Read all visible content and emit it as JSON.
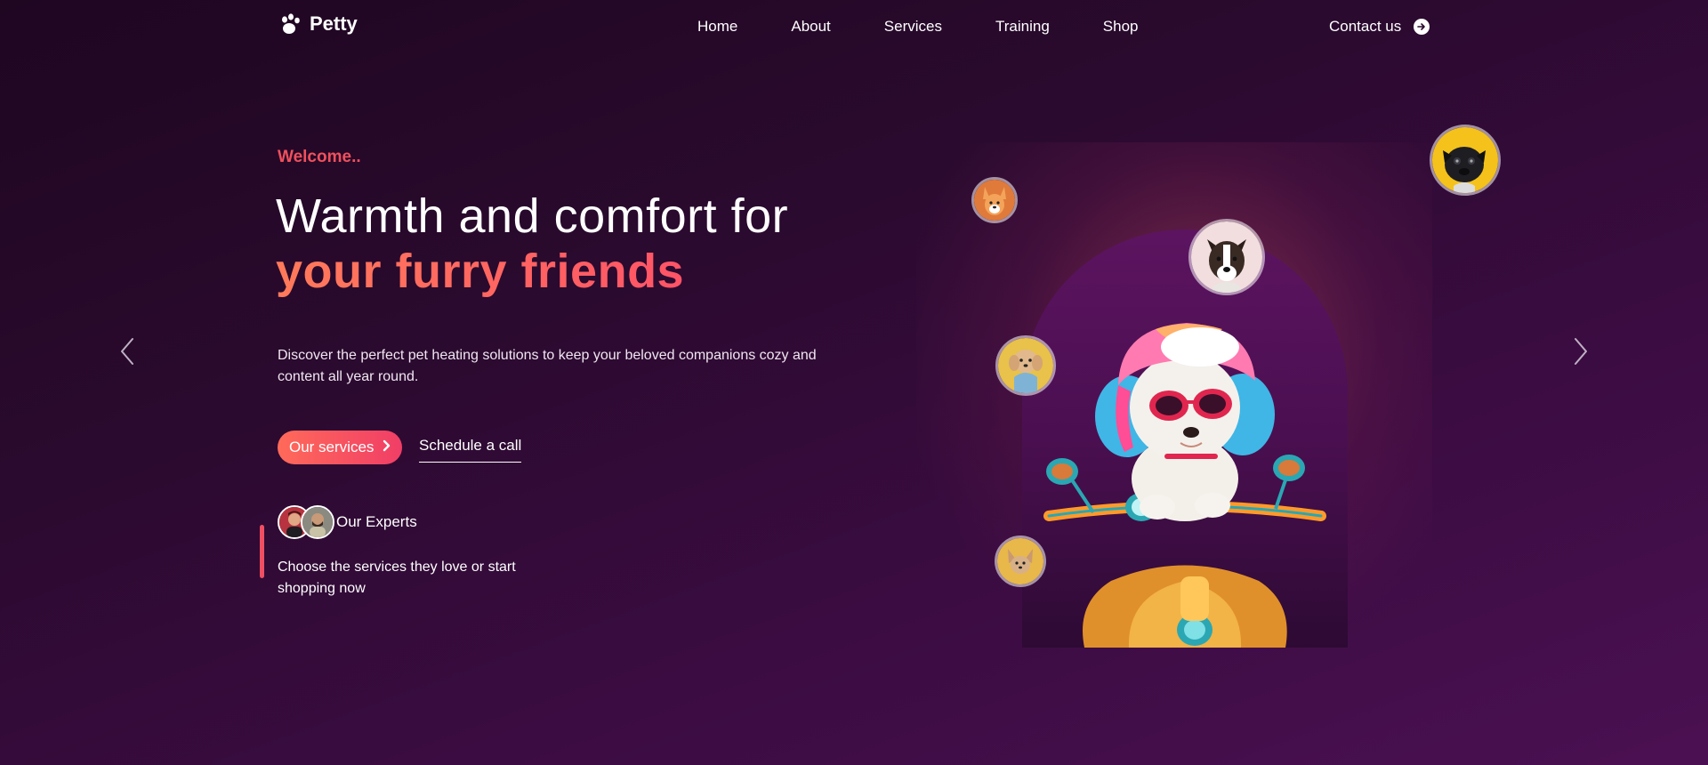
{
  "brand": {
    "name": "Petty",
    "icon": "paw-icon"
  },
  "nav": {
    "items": [
      {
        "label": "Home"
      },
      {
        "label": "About"
      },
      {
        "label": "Services"
      },
      {
        "label": "Training"
      },
      {
        "label": "Shop"
      }
    ],
    "contact_label": "Contact us",
    "contact_icon": "arrow-right-circle-icon"
  },
  "hero": {
    "welcome": "Welcome..",
    "headline_line1": "Warmth and comfort for",
    "headline_line2": "your furry friends",
    "description": "Discover the perfect pet heating solutions to keep your beloved companions cozy and content all year round.",
    "primary_button": "Our services",
    "secondary_button": "Schedule a call",
    "experts_label": "Our Experts",
    "experts_description": "Choose the services they love or start shopping now",
    "prev_icon": "chevron-left-icon",
    "next_icon": "chevron-right-icon"
  },
  "colors": {
    "accent": "#f0505c",
    "accent_gradient_start": "#ff6a5a",
    "accent_gradient_end": "#f03e66",
    "background_top": "#1f0621",
    "background_bottom": "#4b1052"
  }
}
